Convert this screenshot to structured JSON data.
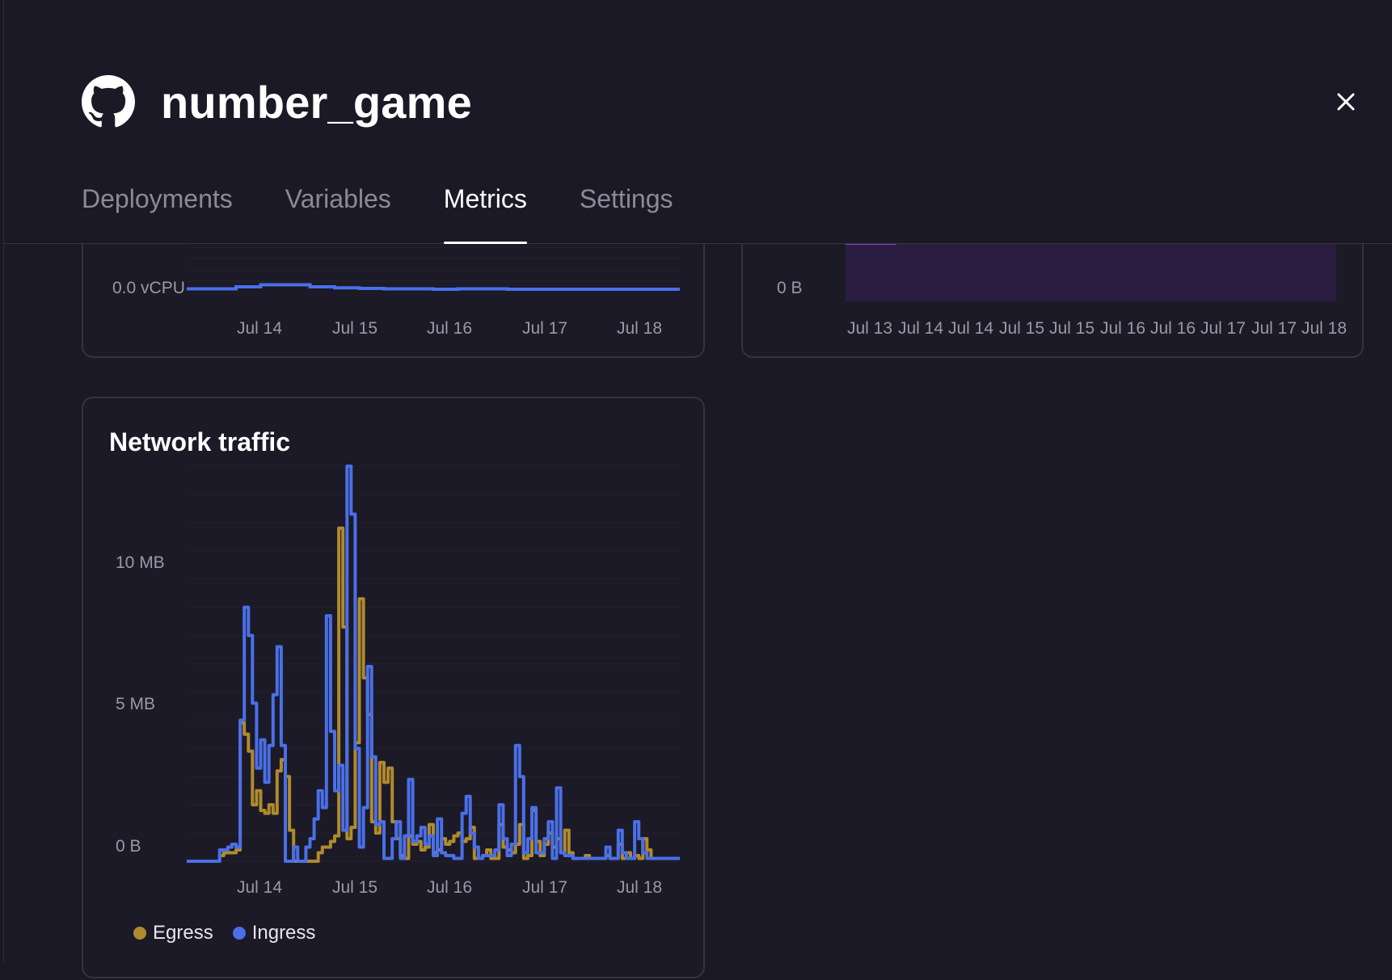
{
  "header": {
    "title": "number_game",
    "tabs": [
      {
        "label": "Deployments",
        "active": false
      },
      {
        "label": "Variables",
        "active": false
      },
      {
        "label": "Metrics",
        "active": true
      },
      {
        "label": "Settings",
        "active": false
      }
    ]
  },
  "colors": {
    "accent_blue": "#4a6fe8",
    "accent_gold": "#b08a2e",
    "memory_purple": "#8a3fd0",
    "background": "#1a1925"
  },
  "icons": {
    "logo": "github-icon",
    "close": "close-icon"
  },
  "chart_data": [
    {
      "type": "line",
      "title": "",
      "ylabel_tick": "0.0 vCPU",
      "x_ticks": [
        "Jul 14",
        "Jul 15",
        "Jul 16",
        "Jul 17",
        "Jul 18"
      ],
      "series": [
        {
          "color": "#4a6fe8",
          "values": [
            0.01,
            0.01,
            0.02,
            0.03,
            0.03,
            0.02,
            0.015,
            0.012,
            0.01,
            0.01,
            0.008,
            0.01,
            0.01,
            0.008,
            0.008,
            0.008,
            0.008,
            0.008,
            0.008,
            0.008
          ]
        }
      ],
      "note_clipped": true
    },
    {
      "type": "area",
      "title": "",
      "ylabel_tick": "0 B",
      "x_ticks": [
        "Jul 13",
        "Jul 14",
        "Jul 14",
        "Jul 15",
        "Jul 15",
        "Jul 16",
        "Jul 16",
        "Jul 17",
        "Jul 17",
        "Jul 18"
      ],
      "series": [
        {
          "color": "#8a3fd0",
          "values": [
            0.72,
            0.72,
            0.73,
            0.73,
            0.74,
            0.74,
            0.74,
            0.74,
            0.74,
            0.74,
            0.74,
            0.74,
            0.74,
            0.74,
            0.74,
            0.74,
            0.74,
            0.74,
            0.74,
            0.74
          ]
        }
      ],
      "note_clipped": true
    },
    {
      "type": "line",
      "title": "Network traffic",
      "y_ticks": [
        "0 B",
        "5 MB",
        "10 MB"
      ],
      "ylim_mb": [
        0,
        14
      ],
      "x_ticks": [
        "Jul 14",
        "Jul 15",
        "Jul 16",
        "Jul 17",
        "Jul 18"
      ],
      "legend": [
        "Egress",
        "Ingress"
      ],
      "series": [
        {
          "name": "Egress",
          "color": "#b08a2e",
          "values": [
            0,
            0,
            0,
            0,
            0,
            0,
            0,
            0,
            0.2,
            0.3,
            0.3,
            0.3,
            0.4,
            4.9,
            4.5,
            3.9,
            2.0,
            2.5,
            1.8,
            1.7,
            2.0,
            1.7,
            3.2,
            3.6,
            3.0,
            1.1,
            0,
            0,
            0,
            0,
            0,
            0,
            0.3,
            0.5,
            0.5,
            0.7,
            0.9,
            11.8,
            8.3,
            0.8,
            1.2,
            4.2,
            9.3,
            6.5,
            5.2,
            1.4,
            1.0,
            3.5,
            2.8,
            3.3,
            1.4,
            0.8,
            0.2,
            0.1,
            0.9,
            0.6,
            0.7,
            0.4,
            0.5,
            1.3,
            0.3,
            0.4,
            0.8,
            0.6,
            0.7,
            0.9,
            1.0,
            0.7,
            0.8,
            1.2,
            0.1,
            0.1,
            0.2,
            0.4,
            0.1,
            0.1,
            1.3,
            0.5,
            0.4,
            0.3,
            0.6,
            1.3,
            0.1,
            0.2,
            1.8,
            0.7,
            0.2,
            0.6,
            1.0,
            0.5,
            0.8,
            0.3,
            1.1,
            0.3,
            0.1,
            0.1,
            0.1,
            0.2,
            0.1,
            0.1,
            0.1,
            0.1,
            0.2,
            0.1,
            0.1,
            0.6,
            0.1,
            0.3,
            0.1,
            0.2,
            0.1,
            0.8,
            0.4,
            0.1,
            0.1,
            0.1,
            0.1,
            0.1,
            0.1,
            0.1
          ]
        },
        {
          "name": "Ingress",
          "color": "#4a6fe8",
          "values": [
            0,
            0,
            0,
            0,
            0,
            0,
            0,
            0,
            0.4,
            0.4,
            0.5,
            0.6,
            0.5,
            5.0,
            9.0,
            8.0,
            5.6,
            3.3,
            4.3,
            2.8,
            4.1,
            5.9,
            7.6,
            4.1,
            0,
            0,
            0.5,
            0,
            0,
            0.5,
            0.8,
            1.5,
            2.5,
            1.9,
            8.7,
            4.6,
            2.5,
            3.4,
            1.1,
            14.0,
            12.3,
            4.0,
            0.5,
            1.9,
            6.9,
            3.7,
            1.3,
            1.4,
            0.1,
            0.1,
            0.8,
            1.4,
            0.1,
            0.9,
            2.9,
            0.7,
            0.9,
            1.2,
            0.6,
            0.9,
            0.2,
            1.5,
            0.3,
            0.2,
            0.2,
            0.1,
            0.1,
            1.7,
            2.3,
            1.0,
            0.5,
            0.1,
            0.2,
            0.2,
            0.2,
            0.4,
            2.0,
            0.8,
            0.2,
            0.6,
            4.1,
            3.0,
            0.3,
            0.8,
            1.9,
            0.3,
            0.3,
            0.8,
            1.4,
            0.1,
            2.6,
            0.3,
            0.2,
            0.2,
            0.1,
            0.1,
            0.1,
            0.1,
            0.1,
            0.1,
            0.1,
            0.1,
            0.5,
            0.1,
            0.1,
            1.1,
            0.3,
            0.1,
            0.1,
            1.4,
            0.8,
            0.3,
            0.1,
            0.1,
            0.1,
            0.1,
            0.1,
            0.1,
            0.1,
            0.1
          ]
        }
      ]
    }
  ]
}
